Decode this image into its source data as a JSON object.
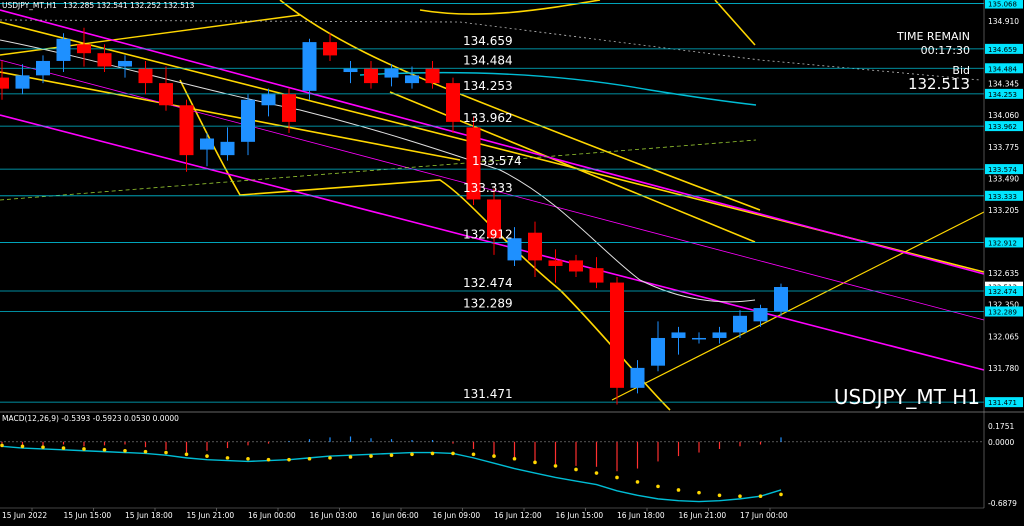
{
  "header": {
    "symbol_info": "USDJPY_MT,H1",
    "ohlc": "132.285 132.541 132.252 132.513"
  },
  "watermark": "USDJPY_MT H1",
  "info_panel": {
    "time_remain_label": "TIME REMAIN",
    "time_remain_value": "00:17:30",
    "bid_label": "Bid",
    "bid_value": "132.513"
  },
  "macd_header": "MACD(12,26,9) -0.5393 -0.5923 0.0530 0.0000",
  "colors": {
    "background": "#000000",
    "bull": "#1e90ff",
    "bear": "#ff0000",
    "level_line": "#00bcd4",
    "channel_magenta": "#ff00ff",
    "trend_yellow": "#ffd700",
    "ma_white": "#e0e0e0",
    "macd_line": "#00bcd4",
    "macd_signal": "#ffd700",
    "tag_bg": "#00e5ff"
  },
  "price_axis_ticks": [
    "135.068",
    "134.910",
    "134.659",
    "134.484",
    "134.345",
    "134.253",
    "134.060",
    "133.962",
    "133.775",
    "133.574",
    "133.490",
    "133.333",
    "133.205",
    "132.912",
    "132.635",
    "132.513",
    "132.474",
    "132.350",
    "132.289",
    "132.065",
    "131.780",
    "131.471"
  ],
  "highlighted_ticks": [
    "135.068",
    "134.659",
    "134.484",
    "134.253",
    "133.962",
    "133.574",
    "133.333",
    "132.912",
    "132.513",
    "132.474",
    "132.289",
    "131.471"
  ],
  "macd_axis_ticks": [
    "0.1751",
    "0.0000",
    "-0.6879"
  ],
  "time_axis_labels": [
    "15 Jun 2022",
    "15 Jun 15:00",
    "15 Jun 18:00",
    "15 Jun 21:00",
    "16 Jun 00:00",
    "16 Jun 03:00",
    "16 Jun 06:00",
    "16 Jun 09:00",
    "16 Jun 12:00",
    "16 Jun 15:00",
    "16 Jun 18:00",
    "16 Jun 21:00",
    "17 Jun 00:00"
  ],
  "level_labels": [
    "135.068",
    "134.659",
    "134.484",
    "134.253",
    "133.962",
    "133.574",
    "133.333",
    "132.912",
    "132.474",
    "132.289",
    "131.471"
  ],
  "chart_data": {
    "type": "candlestick",
    "symbol": "USDJPY_MT",
    "timeframe": "H1",
    "ylim": [
      131.4,
      135.1
    ],
    "horizontal_levels": [
      135.068,
      134.659,
      134.484,
      134.253,
      133.962,
      133.574,
      133.333,
      132.912,
      132.474,
      132.289,
      131.471
    ],
    "current_bid": 132.513,
    "candles": [
      {
        "o": 134.4,
        "h": 134.55,
        "l": 134.2,
        "c": 134.3
      },
      {
        "o": 134.3,
        "h": 134.52,
        "l": 134.25,
        "c": 134.42
      },
      {
        "o": 134.42,
        "h": 134.6,
        "l": 134.35,
        "c": 134.55
      },
      {
        "o": 134.55,
        "h": 134.8,
        "l": 134.45,
        "c": 134.75
      },
      {
        "o": 134.7,
        "h": 134.85,
        "l": 134.5,
        "c": 134.62
      },
      {
        "o": 134.62,
        "h": 134.7,
        "l": 134.45,
        "c": 134.5
      },
      {
        "o": 134.5,
        "h": 134.6,
        "l": 134.4,
        "c": 134.55
      },
      {
        "o": 134.48,
        "h": 134.55,
        "l": 134.25,
        "c": 134.35
      },
      {
        "o": 134.35,
        "h": 134.5,
        "l": 134.1,
        "c": 134.15
      },
      {
        "o": 134.15,
        "h": 134.2,
        "l": 133.55,
        "c": 133.7
      },
      {
        "o": 133.75,
        "h": 133.9,
        "l": 133.6,
        "c": 133.85
      },
      {
        "o": 133.7,
        "h": 133.95,
        "l": 133.65,
        "c": 133.82
      },
      {
        "o": 133.82,
        "h": 134.25,
        "l": 133.7,
        "c": 134.2
      },
      {
        "o": 134.15,
        "h": 134.3,
        "l": 134.05,
        "c": 134.25
      },
      {
        "o": 134.25,
        "h": 134.3,
        "l": 133.9,
        "c": 134.0
      },
      {
        "o": 134.28,
        "h": 134.75,
        "l": 134.2,
        "c": 134.72
      },
      {
        "o": 134.72,
        "h": 134.8,
        "l": 134.55,
        "c": 134.6
      },
      {
        "o": 134.45,
        "h": 134.55,
        "l": 134.35,
        "c": 134.48
      },
      {
        "o": 134.48,
        "h": 134.55,
        "l": 134.3,
        "c": 134.35
      },
      {
        "o": 134.4,
        "h": 134.52,
        "l": 134.32,
        "c": 134.48
      },
      {
        "o": 134.35,
        "h": 134.5,
        "l": 134.3,
        "c": 134.42
      },
      {
        "o": 134.48,
        "h": 134.55,
        "l": 134.3,
        "c": 134.35
      },
      {
        "o": 134.35,
        "h": 134.4,
        "l": 133.9,
        "c": 134.0
      },
      {
        "o": 133.95,
        "h": 134.05,
        "l": 133.25,
        "c": 133.3
      },
      {
        "o": 133.3,
        "h": 133.4,
        "l": 132.8,
        "c": 132.95
      },
      {
        "o": 132.75,
        "h": 133.05,
        "l": 132.7,
        "c": 132.95
      },
      {
        "o": 133.0,
        "h": 133.1,
        "l": 132.6,
        "c": 132.75
      },
      {
        "o": 132.75,
        "h": 132.85,
        "l": 132.55,
        "c": 132.7
      },
      {
        "o": 132.75,
        "h": 132.8,
        "l": 132.6,
        "c": 132.65
      },
      {
        "o": 132.68,
        "h": 132.78,
        "l": 132.5,
        "c": 132.55
      },
      {
        "o": 132.55,
        "h": 132.6,
        "l": 131.45,
        "c": 131.6
      },
      {
        "o": 131.6,
        "h": 131.85,
        "l": 131.55,
        "c": 131.78
      },
      {
        "o": 131.8,
        "h": 132.2,
        "l": 131.75,
        "c": 132.05
      },
      {
        "o": 132.05,
        "h": 132.15,
        "l": 131.9,
        "c": 132.1
      },
      {
        "o": 132.05,
        "h": 132.1,
        "l": 132.0,
        "c": 132.05
      },
      {
        "o": 132.05,
        "h": 132.15,
        "l": 132.0,
        "c": 132.1
      },
      {
        "o": 132.1,
        "h": 132.3,
        "l": 132.05,
        "c": 132.25
      },
      {
        "o": 132.2,
        "h": 132.35,
        "l": 132.15,
        "c": 132.32
      },
      {
        "o": 132.29,
        "h": 132.54,
        "l": 132.25,
        "c": 132.51
      }
    ],
    "macd": {
      "histogram": [
        -0.02,
        -0.06,
        -0.04,
        -0.03,
        -0.05,
        -0.04,
        -0.03,
        -0.06,
        -0.09,
        -0.12,
        -0.1,
        -0.07,
        -0.04,
        -0.02,
        0.01,
        0.03,
        0.05,
        0.06,
        0.04,
        0.03,
        0.02,
        0.02,
        -0.02,
        -0.08,
        -0.16,
        -0.2,
        -0.22,
        -0.25,
        -0.27,
        -0.28,
        -0.33,
        -0.3,
        -0.22,
        -0.16,
        -0.12,
        -0.08,
        -0.05,
        -0.03,
        0.05
      ],
      "macd_line": [
        -0.05,
        -0.07,
        -0.08,
        -0.09,
        -0.1,
        -0.11,
        -0.12,
        -0.13,
        -0.15,
        -0.18,
        -0.2,
        -0.21,
        -0.22,
        -0.21,
        -0.2,
        -0.18,
        -0.16,
        -0.15,
        -0.14,
        -0.13,
        -0.12,
        -0.12,
        -0.13,
        -0.18,
        -0.24,
        -0.3,
        -0.35,
        -0.4,
        -0.44,
        -0.48,
        -0.55,
        -0.6,
        -0.64,
        -0.66,
        -0.67,
        -0.66,
        -0.64,
        -0.61,
        -0.54
      ],
      "signal": [
        -0.04,
        -0.05,
        -0.06,
        -0.07,
        -0.08,
        -0.09,
        -0.1,
        -0.11,
        -0.12,
        -0.14,
        -0.16,
        -0.18,
        -0.19,
        -0.2,
        -0.2,
        -0.19,
        -0.18,
        -0.17,
        -0.16,
        -0.15,
        -0.14,
        -0.13,
        -0.13,
        -0.14,
        -0.16,
        -0.19,
        -0.23,
        -0.27,
        -0.31,
        -0.35,
        -0.4,
        -0.45,
        -0.5,
        -0.54,
        -0.57,
        -0.6,
        -0.61,
        -0.61,
        -0.59
      ],
      "ylim": [
        -0.72,
        0.2
      ]
    }
  }
}
